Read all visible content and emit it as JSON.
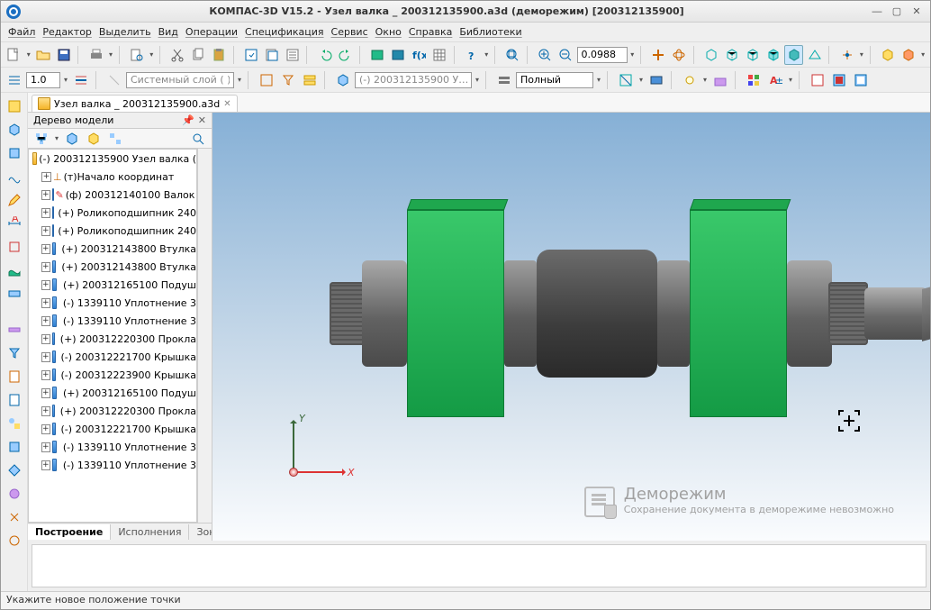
{
  "title": "КОМПАС-3D V15.2  - Узел валка _ 200312135900.a3d (деморежим) [200312135900]",
  "menu": [
    "Файл",
    "Редактор",
    "Выделить",
    "Вид",
    "Операции",
    "Спецификация",
    "Сервис",
    "Окно",
    "Справка",
    "Библиотеки"
  ],
  "toolbar1_zoom_value": "0.0988",
  "toolbar2": {
    "line_width": "1.0",
    "layer_name": "Системный слой ( )",
    "ref_name": "(-) 200312135900 У…",
    "display_mode": "Полный"
  },
  "doc_tab": "Узел валка _ 200312135900.a3d",
  "tree": {
    "title": "Дерево модели",
    "root": "(-) 200312135900 Узел валка (",
    "origin": "(т)Начало координат",
    "items": [
      "(ф) 200312140100 Валок в",
      "(+) Роликоподшипник 240",
      "(+) Роликоподшипник 240",
      "(+) 200312143800 Втулка",
      "(+) 200312143800 Втулка",
      "(+) 200312165100 Подуш",
      "(-) 1339110 Уплотнение 3",
      "(-) 1339110 Уплотнение 3",
      "(+) 200312220300 Прокла",
      "(-) 200312221700 Крышка",
      "(-) 200312223900 Крышка",
      "(+) 200312165100 Подуш",
      "(+) 200312220300 Прокла",
      "(-) 200312221700 Крышка",
      "(-) 1339110 Уплотнение 3",
      "(-) 1339110 Уплотнение 3"
    ]
  },
  "bottom_tabs": [
    "Построение",
    "Исполнения",
    "Зоны"
  ],
  "demo": {
    "h": "Деморежим",
    "s": "Сохранение документа в деморежиме невозможно"
  },
  "axes": {
    "x": "X",
    "y": "Y"
  },
  "status": "Укажите новое положение точки"
}
